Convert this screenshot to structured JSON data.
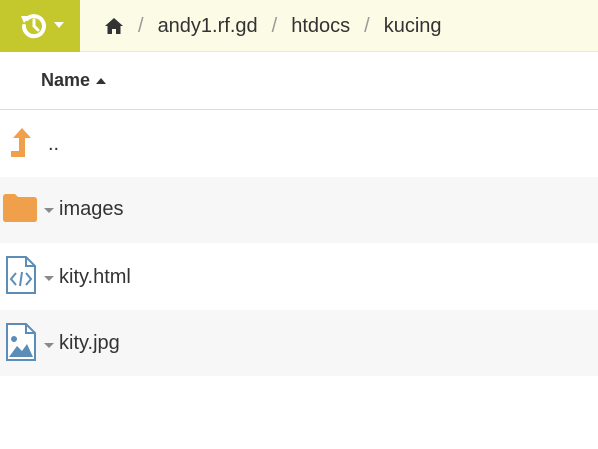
{
  "toolbar": {
    "history_icon": "history-icon",
    "accent_color": "#c5c82d"
  },
  "breadcrumb": {
    "home_icon": "home-icon",
    "separator": "/",
    "items": [
      "andy1.rf.gd",
      "htdocs",
      "kucing"
    ]
  },
  "table": {
    "column_name": "Name",
    "sort": "ascending"
  },
  "rows": [
    {
      "name": "..",
      "icon": "parent-folder-arrow-icon"
    },
    {
      "name": "images",
      "icon": "folder-icon"
    },
    {
      "name": "kity.html",
      "icon": "code-file-icon"
    },
    {
      "name": "kity.jpg",
      "icon": "image-file-icon"
    }
  ]
}
